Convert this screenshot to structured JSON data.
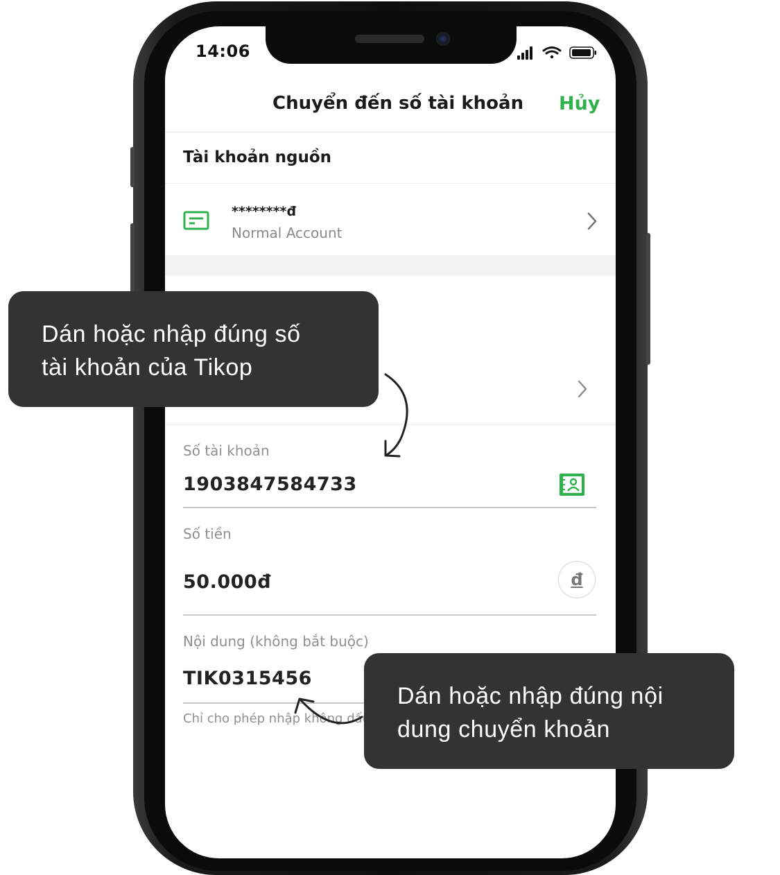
{
  "status_bar": {
    "time": "14:06"
  },
  "nav": {
    "title": "Chuyển đến số tài khoản",
    "cancel_label": "Hủy"
  },
  "source_account": {
    "section_title": "Tài khoản nguồn",
    "balance_masked": "********đ",
    "account_type": "Normal Account"
  },
  "form": {
    "account_number": {
      "label": "Số tài khoản",
      "value": "1903847584733"
    },
    "amount": {
      "label": "Số tiền",
      "value": "50.000đ",
      "currency_symbol": "đ"
    },
    "content": {
      "label": "Nội dung (không bắt buộc)",
      "value": "TIK0315456",
      "hint": "Chỉ cho phép nhập không dấu"
    }
  },
  "callouts": [
    {
      "line1": "Dán hoặc nhập đúng số",
      "line2": "tài khoản của Tikop"
    },
    {
      "line1": "Dán hoặc nhập đúng nội",
      "line2": "dung chuyển khoản"
    }
  ],
  "colors": {
    "accent": "#2fb14c",
    "callout_bg": "#333333"
  },
  "icons": [
    "signal-icon",
    "wifi-icon",
    "battery-icon",
    "card-icon",
    "chevron-right-icon",
    "contacts-icon",
    "currency-icon"
  ]
}
